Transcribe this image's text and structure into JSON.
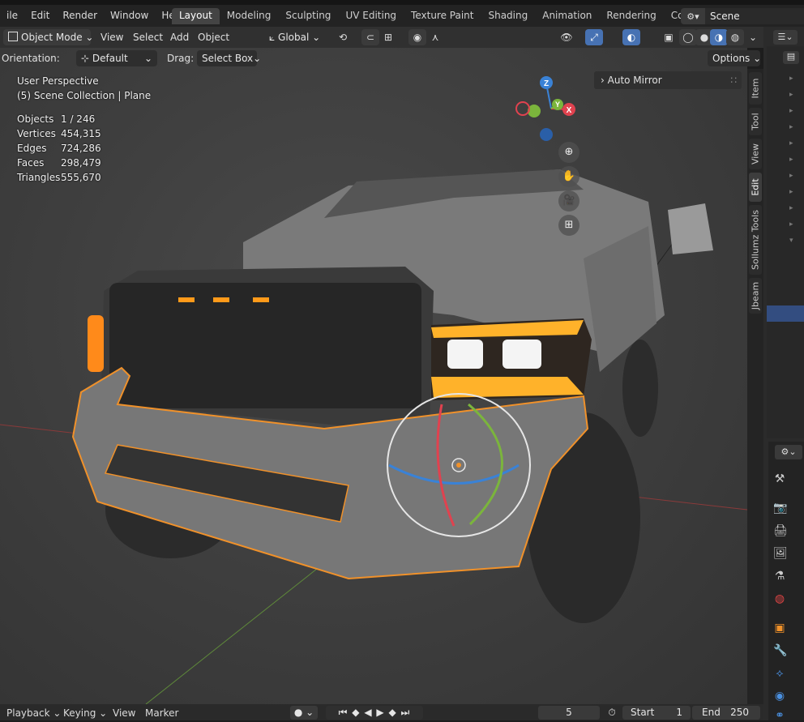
{
  "menu": [
    "ile",
    "Edit",
    "Render",
    "Window",
    "Help"
  ],
  "workspaces": [
    "Layout",
    "Modeling",
    "Sculpting",
    "UV Editing",
    "Texture Paint",
    "Shading",
    "Animation",
    "Rendering",
    "Compositing"
  ],
  "active_workspace": "Layout",
  "scene_name": "Scene",
  "header": {
    "mode": "Object Mode",
    "view": "View",
    "select": "Select",
    "add": "Add",
    "object": "Object",
    "orientation_global": "Global"
  },
  "tool_header": {
    "orientation_label": "Orientation:",
    "orientation_value": "Default",
    "drag_label": "Drag:",
    "drag_value": "Select Box",
    "options": "Options"
  },
  "viewport": {
    "perspective": "User Perspective",
    "collection": "(5) Scene Collection | Plane",
    "stats": [
      {
        "label": "Objects",
        "value": "1 / 246"
      },
      {
        "label": "Vertices",
        "value": "454,315"
      },
      {
        "label": "Edges",
        "value": "724,286"
      },
      {
        "label": "Faces",
        "value": "298,479"
      },
      {
        "label": "Triangles",
        "value": "555,670"
      }
    ],
    "gizmo_axes": {
      "z": "Z",
      "y": "Y",
      "x": "X"
    }
  },
  "npanel": {
    "panel_title": "Auto Mirror",
    "tabs": [
      "Item",
      "Tool",
      "View",
      "Edit",
      "Sollumz Tools",
      "Jbeam"
    ],
    "active_tab": "Edit"
  },
  "timeline": {
    "playback": "Playback",
    "keying": "Keying",
    "view": "View",
    "marker": "Marker",
    "current_frame": "5",
    "start_label": "Start",
    "start_value": "1",
    "end_label": "End",
    "end_value": "250"
  },
  "colors": {
    "selection_outline": "#f0912a",
    "headlight_glow": "#ffb22a",
    "axis_x": "#e0424f",
    "axis_y": "#7bb53c",
    "axis_z": "#3a82d6",
    "accent_blue": "#4772b3"
  }
}
